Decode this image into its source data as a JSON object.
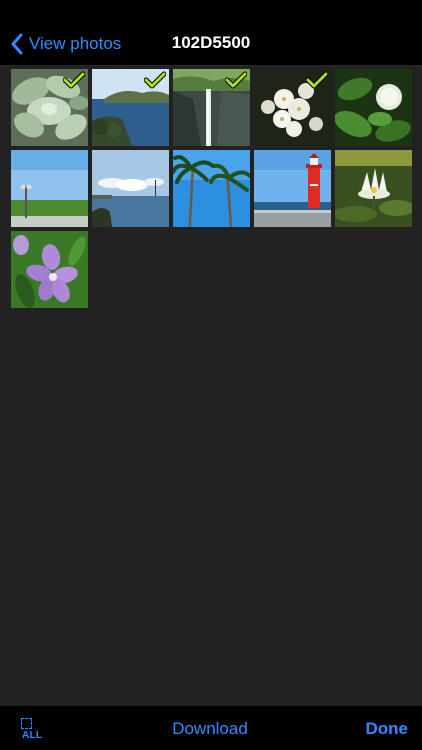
{
  "navbar": {
    "back_label": "View photos",
    "title": "102D5500"
  },
  "photos": [
    {
      "subject": "succulent",
      "selected": true
    },
    {
      "subject": "coastal-bay",
      "selected": true
    },
    {
      "subject": "waterfall-cliff",
      "selected": true
    },
    {
      "subject": "white-flowers",
      "selected": true
    },
    {
      "subject": "white-hydrangea-leaves",
      "selected": false
    },
    {
      "subject": "lamp-post-field",
      "selected": false
    },
    {
      "subject": "harbor-sky",
      "selected": false
    },
    {
      "subject": "palm-trees",
      "selected": false
    },
    {
      "subject": "red-lighthouse",
      "selected": false
    },
    {
      "subject": "water-lily",
      "selected": false
    },
    {
      "subject": "purple-flower",
      "selected": false
    }
  ],
  "toolbar": {
    "select_all_label": "ALL",
    "download_label": "Download",
    "done_label": "Done"
  },
  "colors": {
    "accent": "#2f8cff",
    "check": "#a8e023",
    "background": "#222222",
    "bars": "#000000"
  }
}
